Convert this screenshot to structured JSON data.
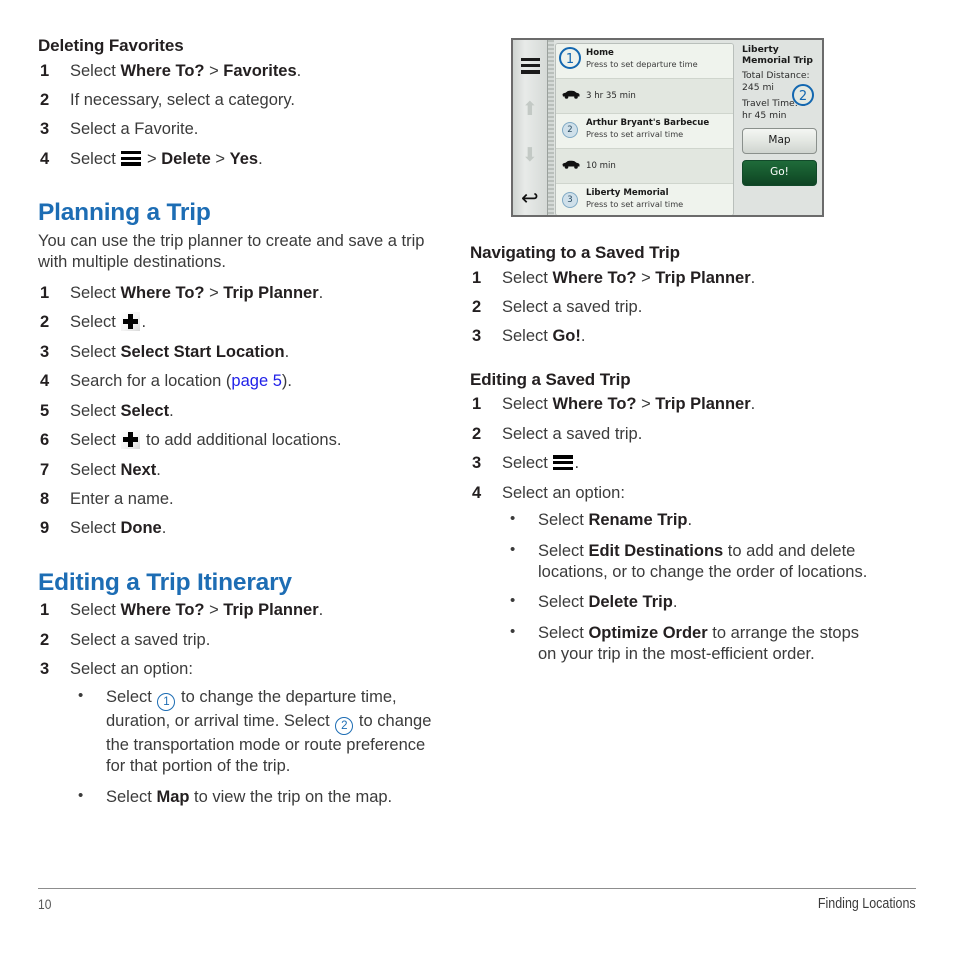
{
  "document": {
    "page_number": "10",
    "footer_section": "Finding Locations"
  },
  "left_column": {
    "deleting_favorites": {
      "heading": "Deleting Favorites",
      "steps": [
        {
          "num": "1",
          "pre": "Select ",
          "bold1": "Where To?",
          "mid": " > ",
          "bold2": "Favorites",
          "post": "."
        },
        {
          "num": "2",
          "text": "If necessary, select a category."
        },
        {
          "num": "3",
          "text": "Select a Favorite."
        },
        {
          "num": "4",
          "pre": "Select ",
          "icon": "hamburger-icon",
          "mid": " > ",
          "bold1": "Delete",
          "mid2": " > ",
          "bold2": "Yes",
          "post": "."
        }
      ]
    },
    "planning_a_trip": {
      "heading": "Planning a Trip",
      "intro": "You can use the trip planner to create and save a trip with multiple destinations.",
      "steps": [
        {
          "num": "1",
          "pre": "Select ",
          "bold1": "Where To?",
          "mid": " > ",
          "bold2": "Trip Planner",
          "post": "."
        },
        {
          "num": "2",
          "pre": "Select ",
          "icon": "plus-icon",
          "post": "."
        },
        {
          "num": "3",
          "pre": "Select ",
          "bold1": "Select Start Location",
          "post": "."
        },
        {
          "num": "4",
          "pre": "Search for a location (",
          "link": "page 5",
          "post": ")."
        },
        {
          "num": "5",
          "pre": "Select ",
          "bold1": "Select",
          "post": "."
        },
        {
          "num": "6",
          "pre": "Select ",
          "icon": "plus-icon",
          "post": " to add additional locations."
        },
        {
          "num": "7",
          "pre": "Select ",
          "bold1": "Next",
          "post": "."
        },
        {
          "num": "8",
          "text": "Enter a name."
        },
        {
          "num": "9",
          "pre": "Select ",
          "bold1": "Done",
          "post": "."
        }
      ]
    },
    "editing_trip_itinerary": {
      "heading": "Editing a Trip Itinerary",
      "steps": [
        {
          "num": "1",
          "pre": "Select ",
          "bold1": "Where To?",
          "mid": " > ",
          "bold2": "Trip Planner",
          "post": "."
        },
        {
          "num": "2",
          "text": "Select a saved trip."
        },
        {
          "num": "3",
          "text": "Select an option:"
        }
      ],
      "bullets": [
        {
          "pre": "Select ",
          "circ1": "1",
          "mid": " to change the departure time, duration, or arrival time. Select ",
          "circ2": "2",
          "post": " to change the transportation mode or route preference for that portion of the trip."
        },
        {
          "pre": "Select ",
          "bold1": "Map",
          "post": " to view the trip on the map."
        }
      ]
    }
  },
  "right_column": {
    "navigating_saved_trip": {
      "heading": "Navigating to a Saved Trip",
      "steps": [
        {
          "num": "1",
          "pre": "Select ",
          "bold1": "Where To?",
          "mid": " > ",
          "bold2": "Trip Planner",
          "post": "."
        },
        {
          "num": "2",
          "text": "Select a saved trip."
        },
        {
          "num": "3",
          "pre": "Select ",
          "bold1": "Go!",
          "post": "."
        }
      ]
    },
    "editing_saved_trip": {
      "heading": "Editing a Saved Trip",
      "steps": [
        {
          "num": "1",
          "pre": "Select ",
          "bold1": "Where To?",
          "mid": " > ",
          "bold2": "Trip Planner",
          "post": "."
        },
        {
          "num": "2",
          "text": "Select a saved trip."
        },
        {
          "num": "3",
          "pre": "Select ",
          "icon": "hamburger-icon",
          "post": "."
        },
        {
          "num": "4",
          "text": "Select an option:"
        }
      ],
      "bullets": [
        {
          "pre": "Select ",
          "bold1": "Rename Trip",
          "post": "."
        },
        {
          "pre": "Select ",
          "bold1": "Edit Destinations",
          "post": " to add and delete locations, or to change the order of locations."
        },
        {
          "pre": "Select ",
          "bold1": "Delete Trip",
          "post": "."
        },
        {
          "pre": "Select ",
          "bold1": "Optimize Order",
          "post": " to arrange the stops on your trip in the most-efficient order."
        }
      ]
    }
  },
  "figure_device_screen": {
    "sidebar": {
      "menu_icon": "hamburger-icon",
      "up_icon": "arrow-up-icon",
      "down_icon": "arrow-down-icon",
      "back_icon": "back-arrow-icon"
    },
    "callout_1": "1",
    "callout_2": "2",
    "rows": [
      {
        "badge": "1",
        "title": "Home",
        "sub": "Press to set departure time"
      },
      {
        "icon": "car-icon",
        "time": "3 hr 35 min"
      },
      {
        "badge": "2",
        "title": "Arthur Bryant's Barbecue",
        "sub": "Press to set arrival time"
      },
      {
        "icon": "car-icon",
        "time": "10 min"
      },
      {
        "badge": "3",
        "title": "Liberty Memorial",
        "sub": "Press to set arrival time"
      }
    ],
    "summary": {
      "trip_name": "Liberty Memorial Trip",
      "total_distance": "Total Distance: 245 mi",
      "travel_time": "Travel Time: 3 hr 45 min",
      "map_button": "Map",
      "go_button": "Go!"
    }
  },
  "colors": {
    "heading_blue": "#1d6db4",
    "link_blue": "#1f1fe8",
    "body_text": "#3b3b3b",
    "go_button_green": "#15562c",
    "callout_blue": "#1367b0"
  }
}
